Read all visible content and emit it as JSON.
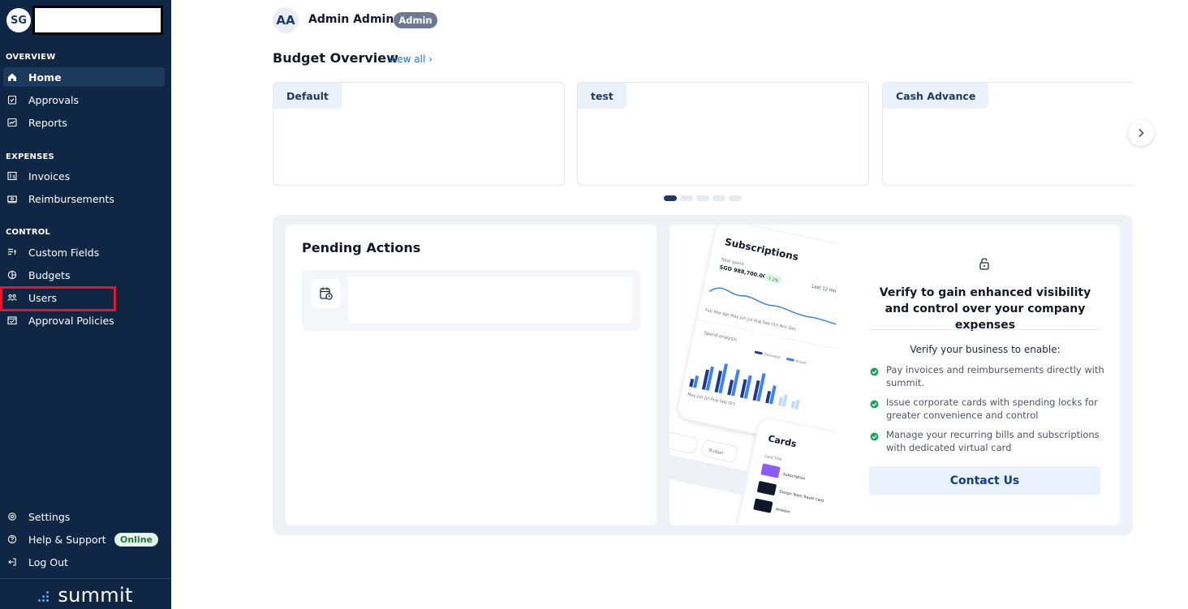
{
  "sidebar": {
    "org_initials": "SG",
    "sections": {
      "overview": "OVERVIEW",
      "expenses": "EXPENSES",
      "control": "CONTROL"
    },
    "items": {
      "home": "Home",
      "approvals": "Approvals",
      "reports": "Reports",
      "invoices": "Invoices",
      "reimbursements": "Reimbursements",
      "custom_fields": "Custom Fields",
      "budgets": "Budgets",
      "users": "Users",
      "approval_policies": "Approval Policies",
      "settings": "Settings",
      "help_support": "Help & Support",
      "log_out": "Log Out"
    },
    "online_badge": "Online",
    "brand": "summit"
  },
  "header": {
    "user_initials": "AA",
    "user_name": "Admin Admin",
    "role_badge": "Admin"
  },
  "budget_overview": {
    "title": "Budget Overview",
    "view_all": "View all ›",
    "cards": [
      {
        "tag": "Default"
      },
      {
        "tag": "test"
      },
      {
        "tag": "Cash Advance"
      }
    ],
    "pagination_total": 5,
    "pagination_active": 1
  },
  "pending_actions": {
    "title": "Pending Actions"
  },
  "verify": {
    "title": "Verify to gain enhanced visibility and control over your company expenses",
    "subtitle": "Verify your business to enable:",
    "benefits": [
      "Pay invoices and reimbursements directly with summit.",
      "Issue corporate cards with spending locks for greater convenience and control",
      "Manage your recurring bills and subscriptions with dedicated virtual card"
    ],
    "cta": "Contact Us"
  },
  "promo_image": {
    "subscriptions_label": "Subscriptions",
    "total_spend_label": "Total spend",
    "total_spend_value": "SGD 988,700.00",
    "change_badge": "-7.2%",
    "period_label": "Last 12 months",
    "months_row": "Feb Mar Apr May Jun Jul Aug Sep Oct Nov Dec",
    "spend_analysis_label": "Spend analysis",
    "legend": [
      "Estimated",
      "Actual"
    ],
    "months_row_2": "May Jun Jul Aug Sep Oct",
    "cards_label": "Cards",
    "card_title_label": "Card Title",
    "budget_label": "Budget",
    "card_rows": [
      "Subscription",
      "Design Team Travel Card",
      "Amazon"
    ]
  },
  "colors": {
    "sidebar_bg": "#0f2744",
    "accent": "#1f6fe0",
    "highlight": "#e0182b",
    "success": "#22a55a"
  }
}
